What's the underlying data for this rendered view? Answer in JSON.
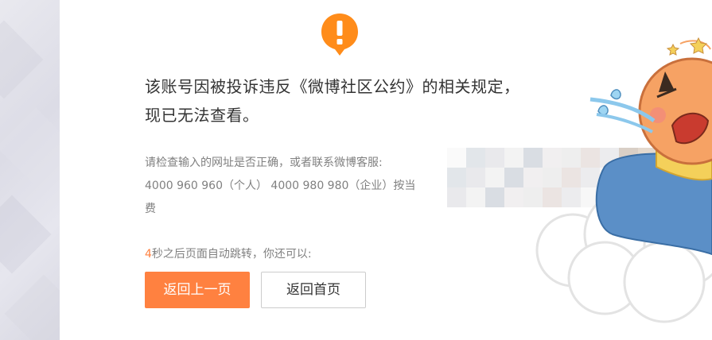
{
  "message": {
    "title": "该账号因被投诉违反《微博社区公约》的相关规定，现已无法查看。",
    "desc_line1": "请检查输入的网址是否正确，或者联系微博客服:",
    "desc_line2": "4000 960 960（个人） 4000 980 980（企业）按当",
    "desc_line3": "费"
  },
  "countdown": {
    "seconds": "4",
    "text": "秒之后页面自动跳转，你还可以:"
  },
  "buttons": {
    "back_label": "返回上一页",
    "home_label": "返回首页"
  },
  "colors": {
    "accent": "#ff8140",
    "alert_icon": "#ff8c1a",
    "text_primary": "#333333",
    "text_secondary": "#808080"
  },
  "icons": {
    "alert": "exclamation-bubble-icon",
    "mascot": "weibo-mascot-illustration"
  }
}
